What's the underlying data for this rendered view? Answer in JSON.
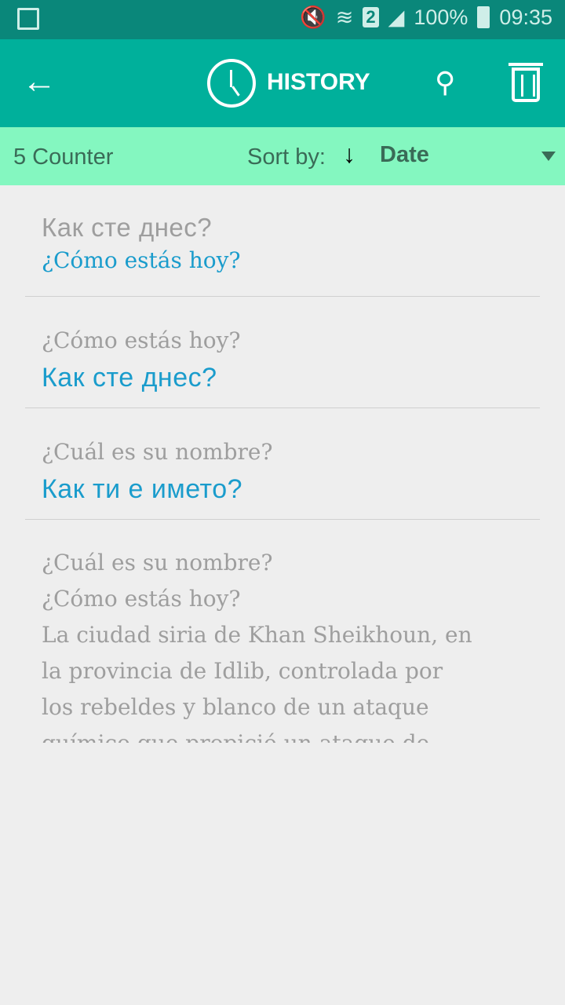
{
  "status_bar": {
    "battery": "100%",
    "time": "09:35",
    "sim": "2"
  },
  "app_bar": {
    "title": "HISTORY"
  },
  "filter_bar": {
    "counter": "5 Counter",
    "sort_label": "Sort by:",
    "sort_value": "Date",
    "sort_direction": "descending"
  },
  "history": [
    {
      "source": "Как сте днес?",
      "translation": "¿Cómo estás hoy?"
    },
    {
      "source": "¿Cómo estás hoy?",
      "translation": "Как сте днес?"
    },
    {
      "source": "¿Cuál es su nombre?",
      "translation": "Как ти е името?"
    },
    {
      "lines": [
        "¿Cuál es su nombre?",
        "¿Cómo estás hoy?",
        "La ciudad siria de Khan Sheikhoun, en",
        "la provincia de Idlib, controlada por",
        "los rebeldes y blanco de un ataque",
        "químico que propició un ataque de"
      ]
    }
  ],
  "colors": {
    "status_bar": "#0a877a",
    "app_bar": "#00b09b",
    "filter_bar": "#84f7c0",
    "translation": "#1a9ccc"
  }
}
